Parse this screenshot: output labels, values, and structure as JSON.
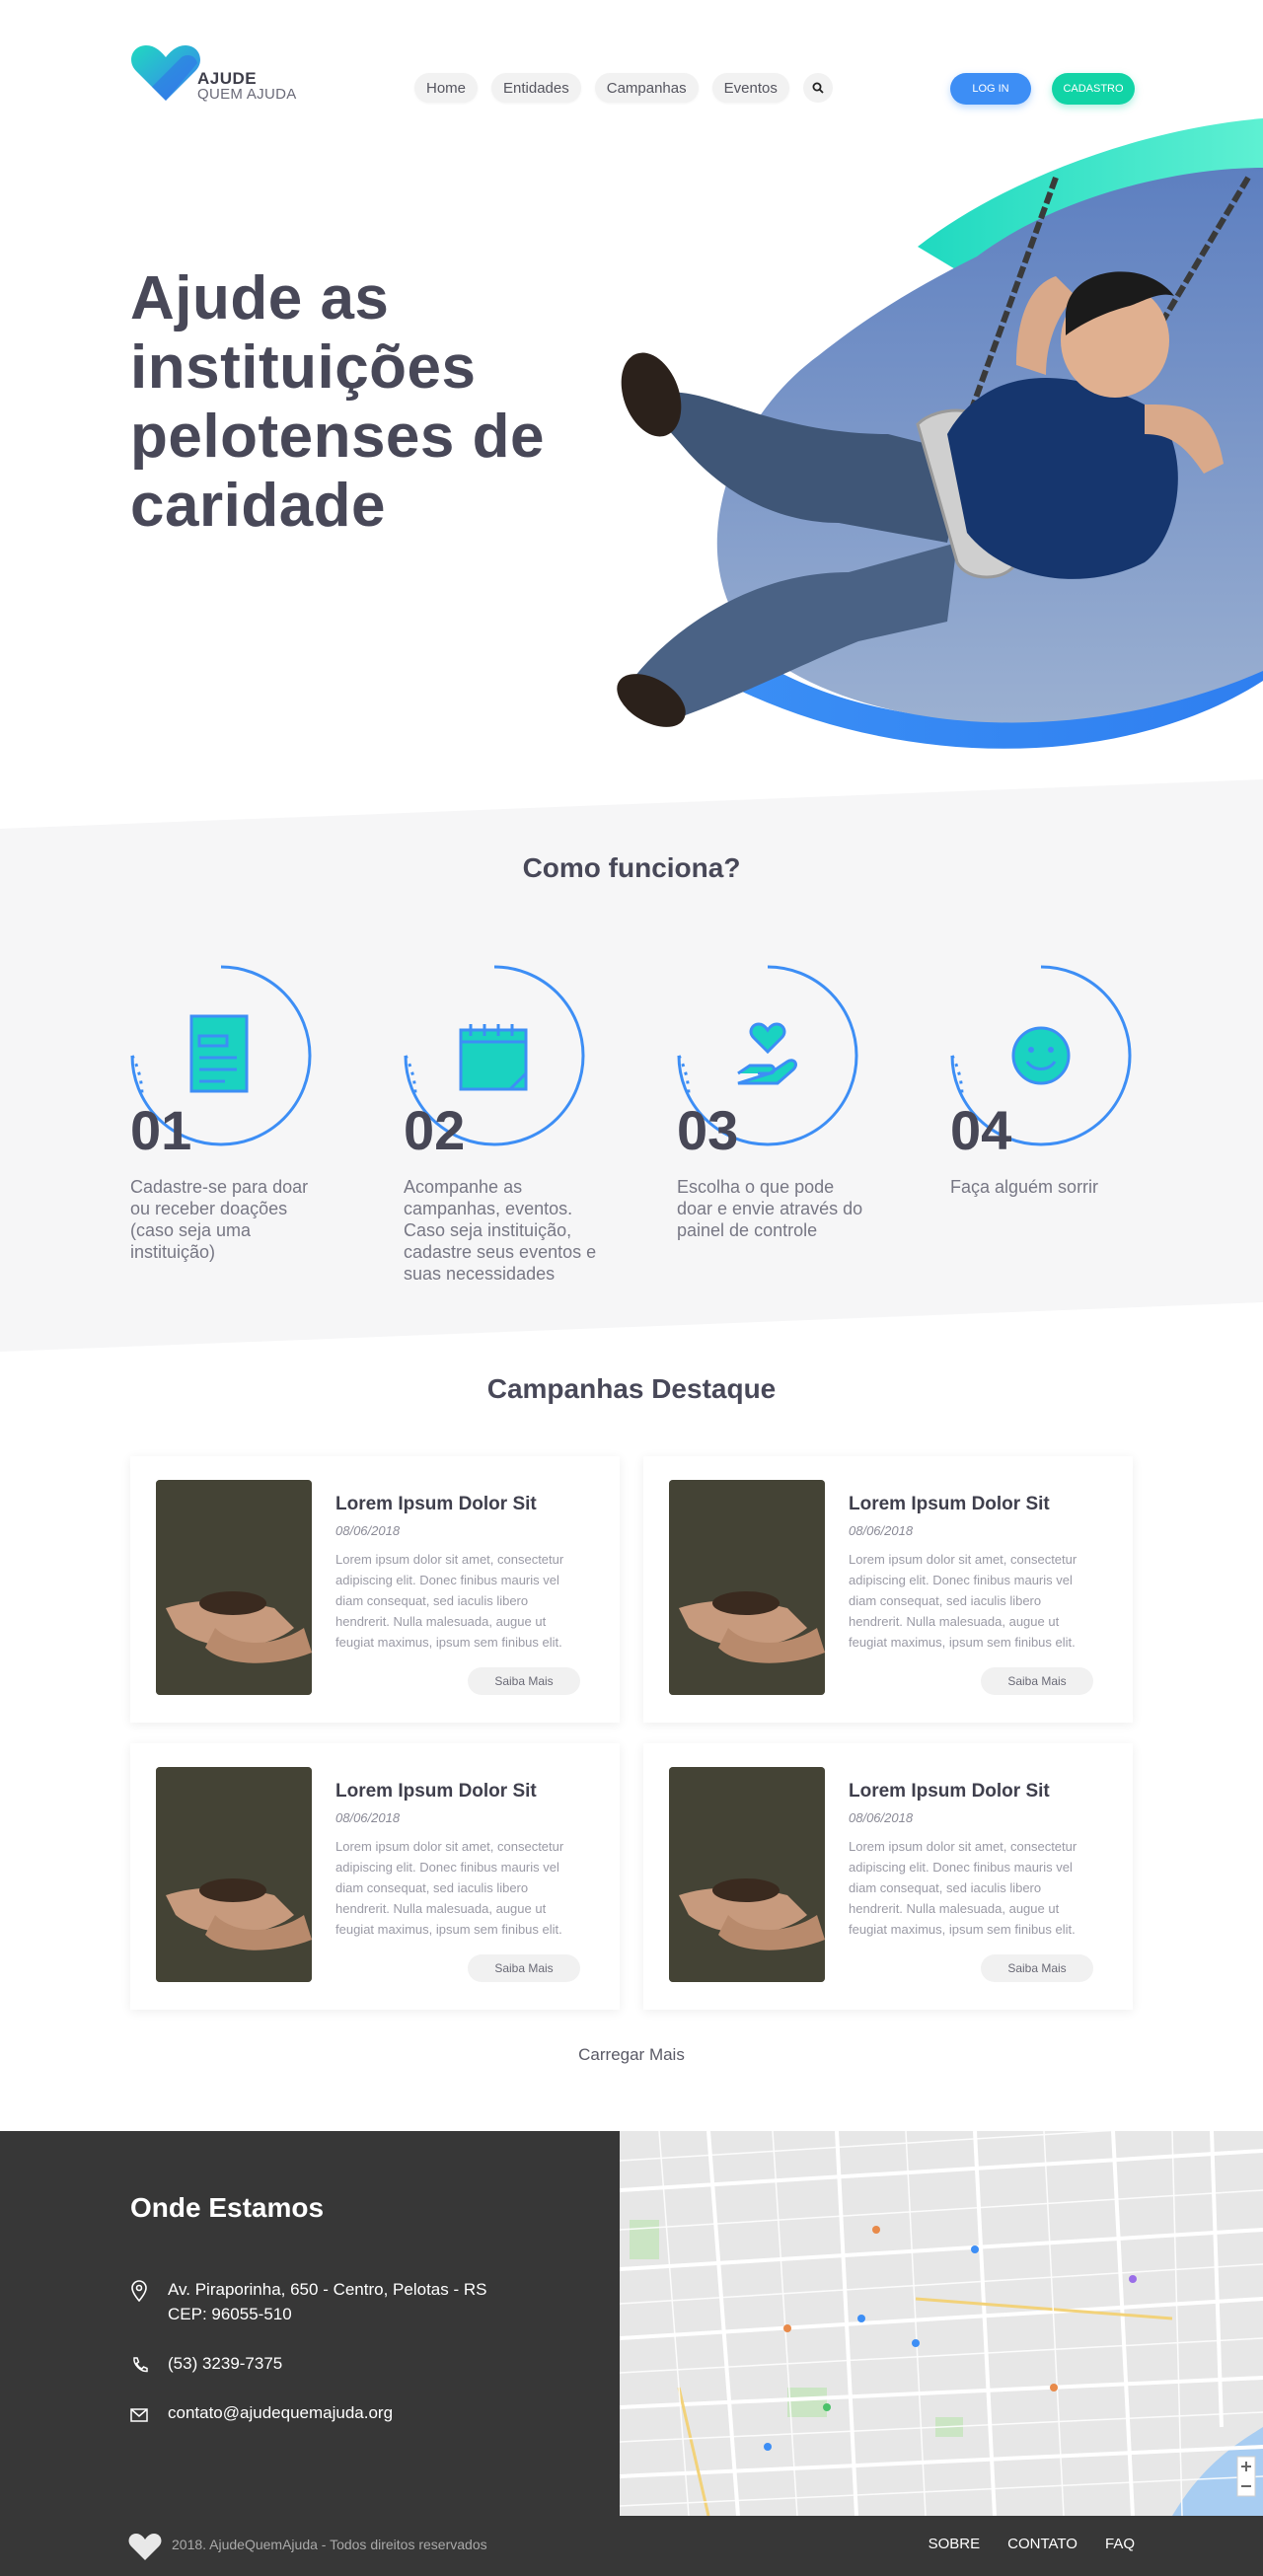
{
  "brand": {
    "line1": "AJUDE",
    "line2": "QUEM AJUDA"
  },
  "nav": {
    "items": [
      {
        "label": "Home"
      },
      {
        "label": "Entidades"
      },
      {
        "label": "Campanhas"
      },
      {
        "label": "Eventos"
      }
    ],
    "login_label": "LOG IN",
    "signup_label": "CADASTRO"
  },
  "hero": {
    "title": "Ajude as instituições pelotenses de caridade"
  },
  "how": {
    "title": "Como funciona?",
    "steps": [
      {
        "number": "01",
        "text": "Cadastre-se para doar ou receber doações (caso seja uma instituição)"
      },
      {
        "number": "02",
        "text": "Acompanhe as campanhas, eventos. Caso seja instituição, cadastre seus eventos e suas necessidades"
      },
      {
        "number": "03",
        "text": "Escolha o que pode doar e envie através do painel de controle"
      },
      {
        "number": "04",
        "text": "Faça alguém sorrir"
      }
    ]
  },
  "campaigns": {
    "title": "Campanhas Destaque",
    "cards": [
      {
        "title": "Lorem Ipsum Dolor Sit",
        "date": "08/06/2018",
        "desc": "Lorem ipsum dolor sit amet, consectetur adipiscing elit. Donec finibus mauris vel diam consequat, sed iaculis libero hendrerit. Nulla malesuada, augue ut feugiat maximus, ipsum sem finibus elit.",
        "button": "Saiba Mais"
      },
      {
        "title": "Lorem Ipsum Dolor Sit",
        "date": "08/06/2018",
        "desc": "Lorem ipsum dolor sit amet, consectetur adipiscing elit. Donec finibus mauris vel diam consequat, sed iaculis libero hendrerit. Nulla malesuada, augue ut feugiat maximus, ipsum sem finibus elit.",
        "button": "Saiba Mais"
      },
      {
        "title": "Lorem Ipsum Dolor Sit",
        "date": "08/06/2018",
        "desc": "Lorem ipsum dolor sit amet, consectetur adipiscing elit. Donec finibus mauris vel diam consequat, sed iaculis libero hendrerit. Nulla malesuada, augue ut feugiat maximus, ipsum sem finibus elit.",
        "button": "Saiba Mais"
      },
      {
        "title": "Lorem Ipsum Dolor Sit",
        "date": "08/06/2018",
        "desc": "Lorem ipsum dolor sit amet, consectetur adipiscing elit. Donec finibus mauris vel diam consequat, sed iaculis libero hendrerit. Nulla malesuada, augue ut feugiat maximus, ipsum sem finibus elit.",
        "button": "Saiba Mais"
      }
    ],
    "load_more": "Carregar Mais"
  },
  "location": {
    "title": "Onde Estamos",
    "address_line1": "Av. Piraporinha, 650 - Centro, Pelotas - RS",
    "address_line2": "CEP: 96055-510",
    "phone": "(53) 3239-7375",
    "email": "contato@ajudequemajuda.org"
  },
  "footer": {
    "copyright": "2018. AjudeQuemAjuda - Todos direitos reservados",
    "links": [
      {
        "label": "SOBRE"
      },
      {
        "label": "CONTATO"
      },
      {
        "label": "FAQ"
      }
    ]
  },
  "colors": {
    "blue": "#3d8ef5",
    "teal": "#11d4a6",
    "dark": "#373737",
    "text": "#484858"
  },
  "icons": [
    "logo-heart-icon",
    "search-icon",
    "document-icon",
    "calendar-icon",
    "heart-hand-icon",
    "smile-icon",
    "location-pin-icon",
    "phone-icon",
    "mail-icon",
    "footer-heart-icon"
  ]
}
